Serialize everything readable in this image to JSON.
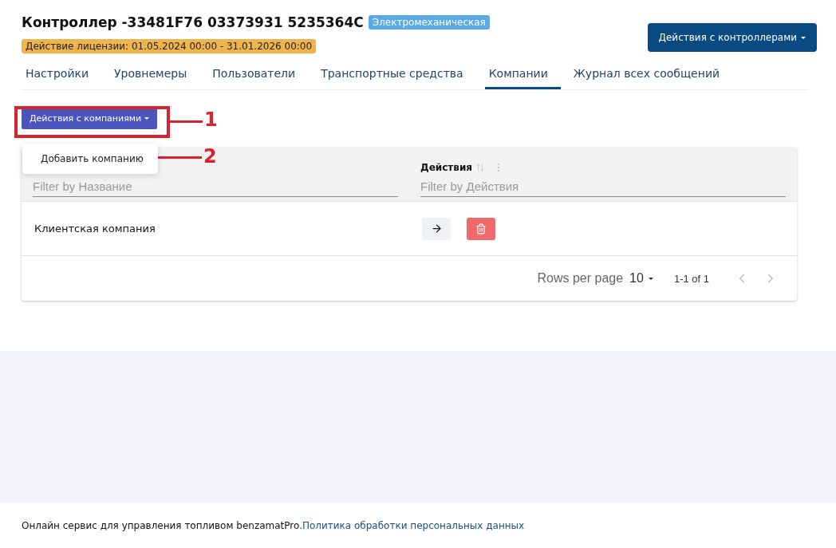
{
  "header": {
    "title": "Контроллер -33481F76 03373931 5235364C",
    "type_badge": "Электромеханическая",
    "license": "Действие лицензии: 01.05.2024 00:00 - 31.01.2026 00:00",
    "actions_button": "Действия с контроллерами"
  },
  "tabs": [
    {
      "label": "Настройки",
      "selected": false
    },
    {
      "label": "Уровнемеры",
      "selected": false
    },
    {
      "label": "Пользователи",
      "selected": false
    },
    {
      "label": "Транспортные средства",
      "selected": false
    },
    {
      "label": "Компании",
      "selected": true
    },
    {
      "label": "Журнал всех сообщений",
      "selected": false
    }
  ],
  "companies_button": "Действия с компаниями",
  "dropdown_menu": {
    "items": [
      "Добавить компанию"
    ]
  },
  "callouts": [
    "1",
    "2"
  ],
  "table": {
    "columns": [
      {
        "filter_placeholder": "Filter by Название"
      },
      {
        "label": "Действия",
        "filter_placeholder": "Filter by Действия"
      }
    ],
    "rows": [
      {
        "name": "Клиентская компания"
      }
    ],
    "pagination": {
      "rows_per_page_label": "Rows per page",
      "rows_per_page": "10",
      "range": "1-1 of 1"
    }
  },
  "footer": {
    "text": "Онлайн сервис для управления топливом benzamatPro.",
    "link": "Политика обработки персональных данных"
  }
}
